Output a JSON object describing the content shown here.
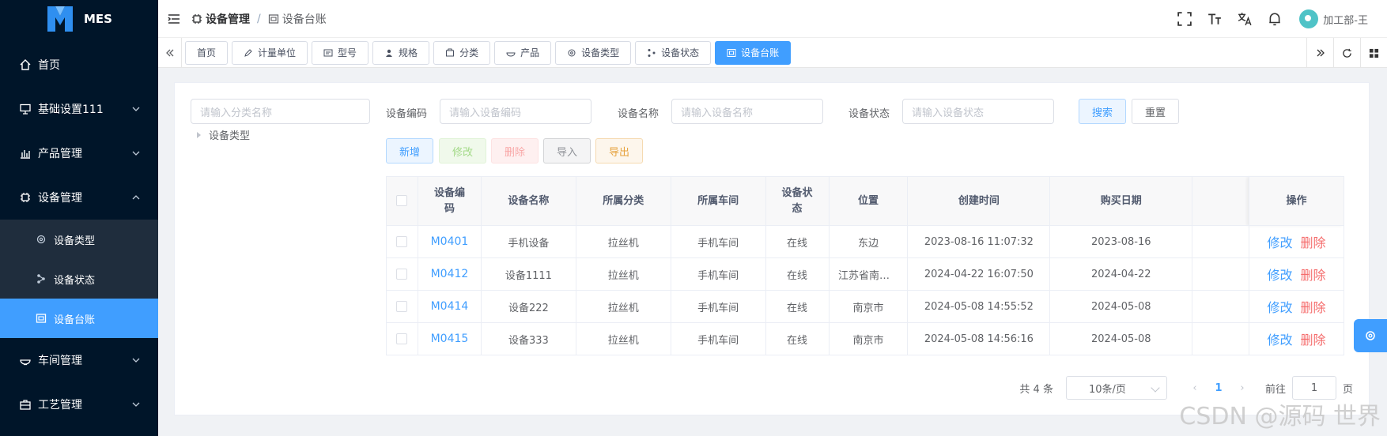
{
  "app": {
    "name": "MES"
  },
  "sidebar": {
    "items": [
      {
        "label": "首页"
      },
      {
        "label": "基础设置111"
      },
      {
        "label": "产品管理"
      },
      {
        "label": "设备管理"
      },
      {
        "label": "车间管理"
      },
      {
        "label": "工艺管理"
      }
    ],
    "submenu": [
      {
        "label": "设备类型"
      },
      {
        "label": "设备状态"
      },
      {
        "label": "设备台账"
      }
    ]
  },
  "breadcrumb": {
    "parent": "设备管理",
    "current": "设备台账"
  },
  "user": {
    "name": "加工部-王"
  },
  "tags": [
    {
      "label": "首页"
    },
    {
      "label": "计量单位"
    },
    {
      "label": "型号"
    },
    {
      "label": "规格"
    },
    {
      "label": "分类"
    },
    {
      "label": "产品"
    },
    {
      "label": "设备类型"
    },
    {
      "label": "设备状态"
    },
    {
      "label": "设备台账"
    }
  ],
  "tree": {
    "placeholder": "请输入分类名称",
    "root": "设备类型"
  },
  "form": {
    "code_label": "设备编码",
    "code_placeholder": "请输入设备编码",
    "name_label": "设备名称",
    "name_placeholder": "请输入设备名称",
    "status_label": "设备状态",
    "status_placeholder": "请输入设备状态",
    "search": "搜索",
    "reset": "重置"
  },
  "toolbar": {
    "add": "新增",
    "edit": "修改",
    "delete": "删除",
    "import": "导入",
    "export": "导出"
  },
  "table": {
    "headers": {
      "code": "设备编码",
      "name": "设备名称",
      "category": "所属分类",
      "workshop": "所属车间",
      "status": "设备状态",
      "location": "位置",
      "created": "创建时间",
      "purchase": "购买日期",
      "ops": "操作"
    },
    "rows": [
      {
        "code": "M0401",
        "name": "手机设备",
        "category": "拉丝机",
        "workshop": "手机车间",
        "status": "在线",
        "location": "东边",
        "created": "2023-08-16 11:07:32",
        "purchase": "2023-08-16"
      },
      {
        "code": "M0412",
        "name": "设备1111",
        "category": "拉丝机",
        "workshop": "手机车间",
        "status": "在线",
        "location": "江苏省南京市",
        "created": "2024-04-22 16:07:50",
        "purchase": "2024-04-22"
      },
      {
        "code": "M0414",
        "name": "设备222",
        "category": "拉丝机",
        "workshop": "手机车间",
        "status": "在线",
        "location": "南京市",
        "created": "2024-05-08 14:55:52",
        "purchase": "2024-05-08"
      },
      {
        "code": "M0415",
        "name": "设备333",
        "category": "拉丝机",
        "workshop": "手机车间",
        "status": "在线",
        "location": "南京市",
        "created": "2024-05-08 14:56:16",
        "purchase": "2024-05-08"
      }
    ],
    "op_edit": "修改",
    "op_delete": "删除"
  },
  "pager": {
    "total": "共 4 条",
    "size": "10条/页",
    "current": "1",
    "goto": "前往",
    "jump_value": "1",
    "page_unit": "页"
  },
  "watermark": "CSDN @源码 世界",
  "colors": {
    "sidebar_bg": "#001529",
    "accent": "#409eff",
    "danger": "#f56c6c"
  }
}
